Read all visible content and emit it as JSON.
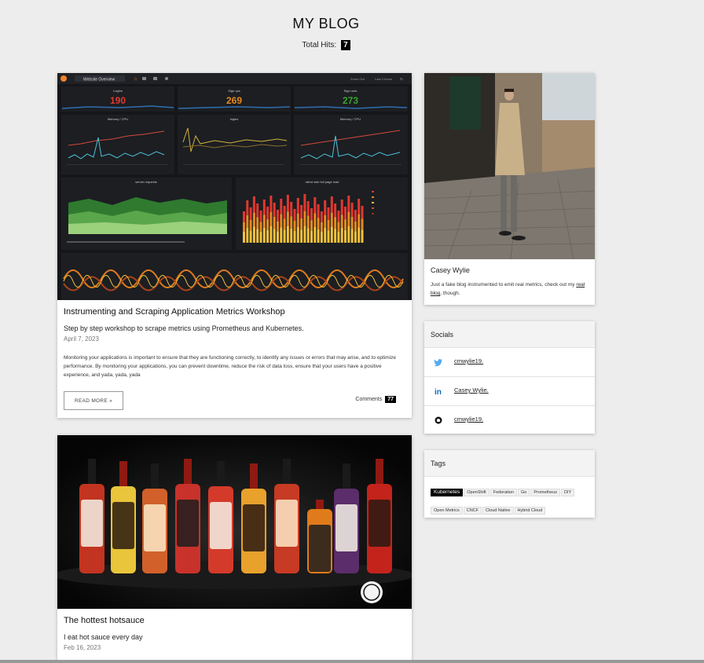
{
  "header": {
    "title": "MY BLOG",
    "hits_label": "Total Hits:",
    "hits_count": "7"
  },
  "posts": [
    {
      "title": "Instrumenting and Scraping Application Metrics Workshop",
      "subtitle": "Step by step workshop to scrape metrics using Prometheus and Kubernetes.",
      "date": "April 7, 2023",
      "excerpt": "Monitoring your applications is important to ensure that they are functioning correctly, to identify any issues or errors that may arise, and to optimize performance. By monitoring your applications, you can prevent downtime, reduce the risk of data loss, ensure that your users have a positive experience, and yada, yada, yada",
      "read_more": "READ MORE »",
      "comments_label": "Comments",
      "comments_count": "77",
      "dashboard": {
        "menu": "Website Overview",
        "topright1": "Zoom Out",
        "topright2": "Last 3 hours",
        "stats": [
          {
            "label": "Logins",
            "value": "190",
            "color": "#e2382f"
          },
          {
            "label": "Sign ups",
            "value": "269",
            "color": "#e58a1f"
          },
          {
            "label": "Sign outs",
            "value": "273",
            "color": "#37a52f"
          }
        ],
        "panels": [
          "Memory / CPU",
          "logins",
          "Memory / CPU",
          "server requests",
          "client side full page load"
        ]
      }
    },
    {
      "title": "The hottest hotsauce",
      "subtitle": "I eat hot sauce every day",
      "date": "Feb 16, 2023"
    }
  ],
  "profile": {
    "name": "Casey Wylie",
    "desc_before": "Just a fake blog instrumented to emit real metrics, check out my ",
    "link": "real blog",
    "desc_after": ", though."
  },
  "socials": {
    "title": "Socials",
    "items": [
      {
        "icon": "twitter-icon",
        "label": "cmwylie19.",
        "color": "#55acee"
      },
      {
        "icon": "linkedin-icon",
        "label": "Casey Wylie.",
        "color": "#0a66c2"
      },
      {
        "icon": "github-icon",
        "label": "cmwylie19.",
        "color": "#111111"
      }
    ]
  },
  "tags": {
    "title": "Tags",
    "items": [
      "Kubernetes",
      "OpenShift",
      "Federation",
      "Go",
      "Prometheus",
      "DIY",
      "Open Metrics",
      "CNCF",
      "Cloud Native",
      "Hybrid Cloud"
    ],
    "active": "Kubernetes"
  }
}
